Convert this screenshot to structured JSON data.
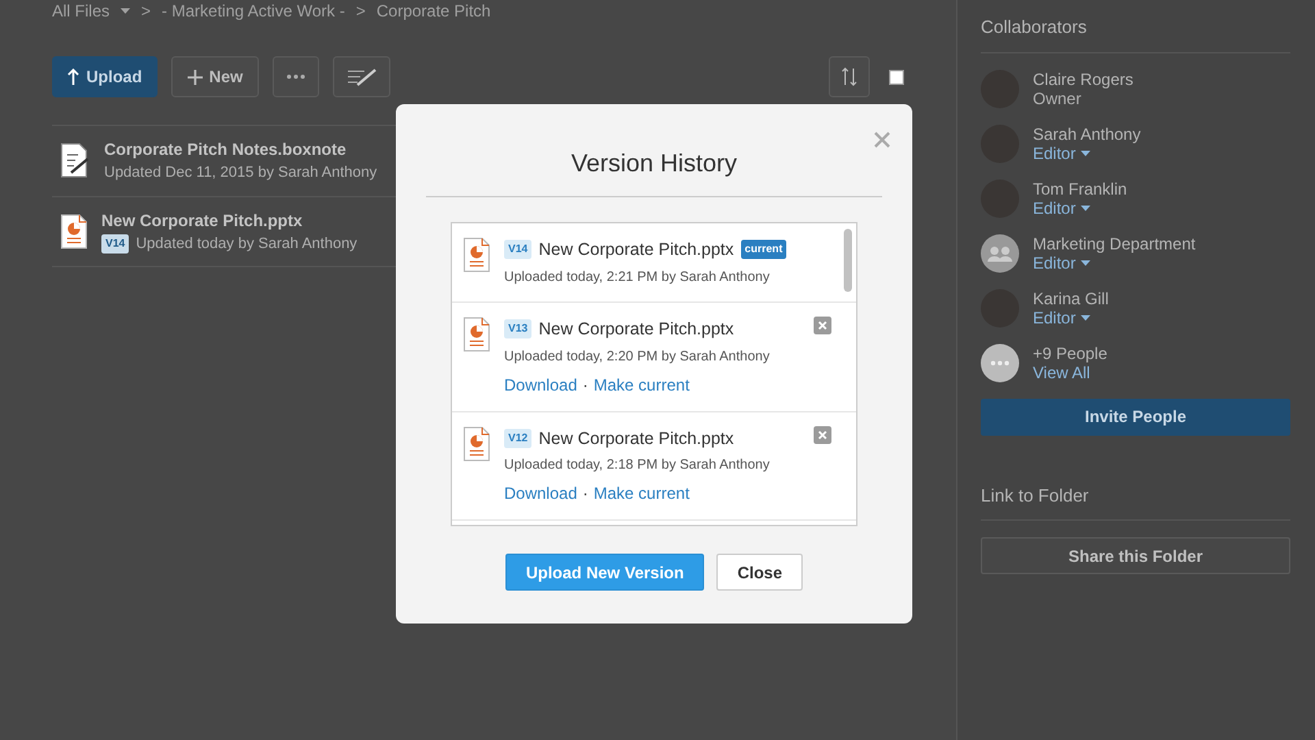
{
  "breadcrumb": {
    "separator": ">",
    "items": [
      {
        "label": "All Files",
        "dropdown": true
      },
      {
        "label": "- Marketing Active Work -",
        "dropdown": false
      },
      {
        "label": "Corporate Pitch",
        "dropdown": false
      }
    ]
  },
  "toolbar": [
    {
      "kind": "upload",
      "label": "Upload"
    },
    {
      "kind": "new",
      "label": "New"
    },
    {
      "kind": "more"
    },
    {
      "kind": "note"
    }
  ],
  "files": [
    {
      "kind": "boxnote",
      "name": "Corporate Pitch Notes.boxnote",
      "meta": "Updated Dec 11, 2015 by Sarah Anthony"
    },
    {
      "kind": "pptx",
      "name": "New Corporate Pitch.pptx",
      "version": "V14",
      "meta": "Updated today by Sarah Anthony"
    }
  ],
  "collaborators": {
    "title": "Collaborators",
    "people": [
      {
        "kind": "person",
        "name": "Claire Rogers",
        "role": "Owner",
        "role_dropdown": false
      },
      {
        "kind": "person",
        "name": "Sarah Anthony",
        "role": "Editor",
        "role_dropdown": true
      },
      {
        "kind": "person",
        "name": "Tom Franklin",
        "role": "Editor",
        "role_dropdown": true
      },
      {
        "kind": "group",
        "name": "Marketing Department",
        "role": "Editor",
        "role_dropdown": true
      },
      {
        "kind": "person",
        "name": "Karina Gill",
        "role": "Editor",
        "role_dropdown": true
      },
      {
        "kind": "more",
        "name": "+9 People",
        "role": "View All",
        "role_dropdown": false
      }
    ],
    "invite_button": "Invite People"
  },
  "link_section": {
    "title": "Link to Folder",
    "button": "Share this Folder"
  },
  "modal": {
    "title": "Version History",
    "action_separator": "·",
    "versions": [
      {
        "version": "V14",
        "name": "New Corporate Pitch.pptx",
        "badge": "current",
        "uploaded": "Uploaded today, 2:21 PM by Sarah Anthony",
        "removable": false
      },
      {
        "version": "V13",
        "name": "New Corporate Pitch.pptx",
        "uploaded": "Uploaded today, 2:20 PM by Sarah Anthony",
        "actions": [
          "Download",
          "Make current"
        ],
        "removable": true
      },
      {
        "version": "V12",
        "name": "New Corporate Pitch.pptx",
        "uploaded": "Uploaded today, 2:18 PM by Sarah Anthony",
        "actions": [
          "Download",
          "Make current"
        ],
        "removable": true
      }
    ],
    "buttons": [
      {
        "kind": "primary",
        "label": "Upload New Version"
      },
      {
        "kind": "secondary",
        "label": "Close"
      }
    ]
  }
}
